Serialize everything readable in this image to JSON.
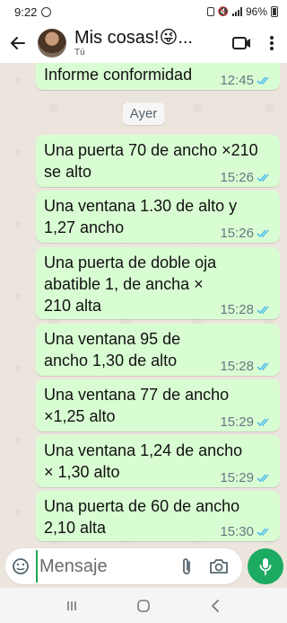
{
  "status_bar": {
    "time": "9:22",
    "battery": "96%"
  },
  "header": {
    "title": "Mis cosas!😜...",
    "subtitle": "Tú"
  },
  "messages": [
    {
      "text": "Informe conformidad",
      "time": "12:45",
      "read": true
    },
    {
      "text": "Una puerta 70 de ancho ×210 se alto",
      "time": "15:26",
      "read": true
    },
    {
      "text": "Una ventana 1.30 de alto y 1,27 ancho",
      "time": "15:26",
      "read": true
    },
    {
      "text": "Una puerta de doble oja abatible 1, de ancha × 210 alta",
      "time": "15:28",
      "read": true
    },
    {
      "text": "Una ventana 95 de ancho 1,30 de alto",
      "time": "15:28",
      "read": true
    },
    {
      "text": "Una ventana 77 de ancho ×1,25 alto",
      "time": "15:29",
      "read": true
    },
    {
      "text": "Una ventana 1,24 de ancho × 1,30 alto",
      "time": "15:29",
      "read": true
    },
    {
      "text": "Una puerta de 60 de ancho 2,10 alta",
      "time": "15:30",
      "read": true
    }
  ],
  "date_divider": "Ayer",
  "composer": {
    "placeholder": "Mensaje"
  },
  "colors": {
    "bubble_out": "#d9fdd3",
    "tick_read": "#53bdeb",
    "accent_green": "#1daa61",
    "chat_bg": "#ece5dd"
  },
  "icons": [
    "back-arrow-icon",
    "video-call-icon",
    "more-vert-icon",
    "emoji-icon",
    "attach-icon",
    "camera-icon",
    "mic-icon"
  ]
}
